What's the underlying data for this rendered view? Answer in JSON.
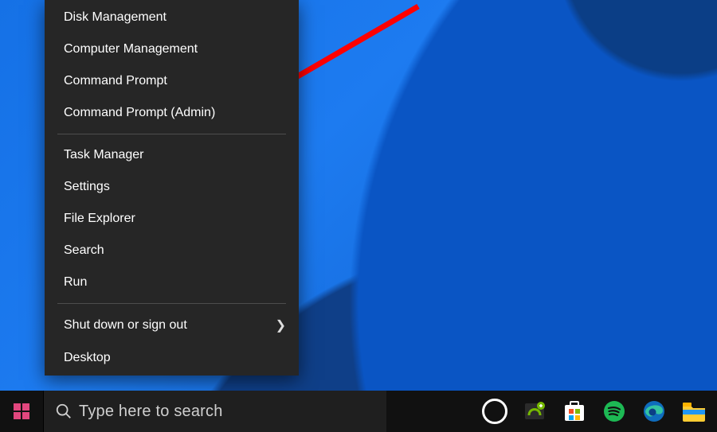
{
  "menu": {
    "groups": [
      {
        "items": [
          {
            "id": "disk-management",
            "label": "Disk Management",
            "sub": false
          },
          {
            "id": "computer-management",
            "label": "Computer Management",
            "sub": false
          },
          {
            "id": "command-prompt",
            "label": "Command Prompt",
            "sub": false
          },
          {
            "id": "command-prompt-admin",
            "label": "Command Prompt (Admin)",
            "sub": false
          }
        ]
      },
      {
        "items": [
          {
            "id": "task-manager",
            "label": "Task Manager",
            "sub": false
          },
          {
            "id": "settings",
            "label": "Settings",
            "sub": false
          },
          {
            "id": "file-explorer",
            "label": "File Explorer",
            "sub": false
          },
          {
            "id": "search",
            "label": "Search",
            "sub": false
          },
          {
            "id": "run",
            "label": "Run",
            "sub": false
          }
        ]
      },
      {
        "items": [
          {
            "id": "shutdown",
            "label": "Shut down or sign out",
            "sub": true
          },
          {
            "id": "desktop",
            "label": "Desktop",
            "sub": false
          }
        ]
      }
    ]
  },
  "taskbar": {
    "search_placeholder": "Type here to search",
    "tray": [
      {
        "id": "cortana",
        "name": "cortana-icon"
      },
      {
        "id": "nvidia",
        "name": "nvidia-icon"
      },
      {
        "id": "ms-store",
        "name": "microsoft-store-icon"
      },
      {
        "id": "spotify",
        "name": "spotify-icon"
      },
      {
        "id": "edge",
        "name": "edge-icon"
      },
      {
        "id": "explorer",
        "name": "file-explorer-icon"
      }
    ]
  },
  "annotation": {
    "target": "command-prompt-admin"
  },
  "colors": {
    "accent": "#e2477e",
    "menu_bg": "#262626"
  }
}
